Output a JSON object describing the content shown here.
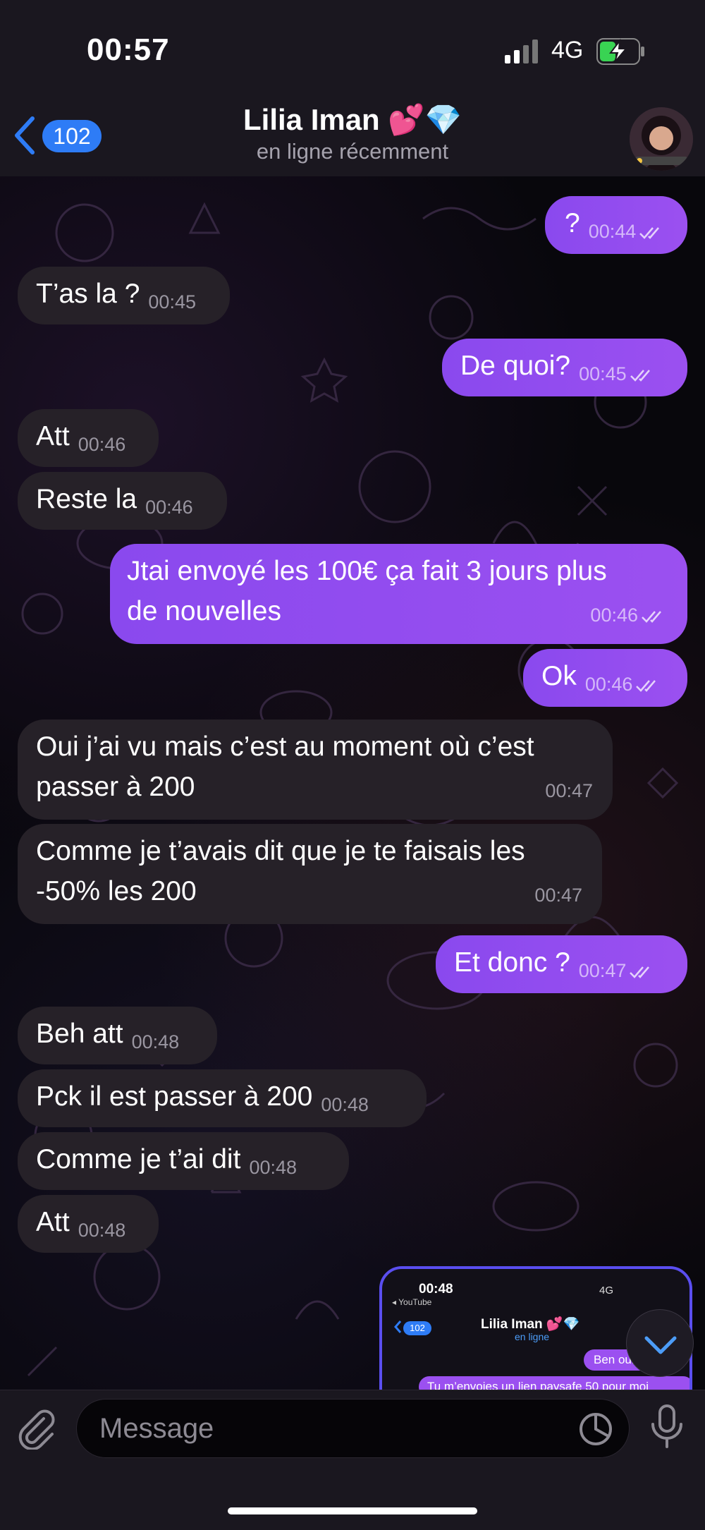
{
  "status": {
    "time": "00:57",
    "network": "4G"
  },
  "header": {
    "back_count": "102",
    "title": "Lilia Iman 💕💎",
    "subtitle": "en ligne récemment"
  },
  "messages": [
    {
      "dir": "out",
      "text": "?",
      "time": "00:44"
    },
    {
      "dir": "in",
      "text": "T’as la ?",
      "time": "00:45"
    },
    {
      "dir": "out",
      "text": "De quoi?",
      "time": "00:45"
    },
    {
      "dir": "in",
      "text": "Att",
      "time": "00:46"
    },
    {
      "dir": "in",
      "text": "Reste la",
      "time": "00:46"
    },
    {
      "dir": "out",
      "text_line1": "Jtai envoyé les 100€ ça fait 3 jours plus",
      "text_line2": "de nouvelles",
      "time": "00:46"
    },
    {
      "dir": "out",
      "text": "Ok",
      "time": "00:46"
    },
    {
      "dir": "in",
      "text_line1": "Oui j’ai vu mais c’est au moment où c’est",
      "text_line2": "passer à 200",
      "time": "00:47"
    },
    {
      "dir": "in",
      "text_line1": "Comme je t’avais dit que je te faisais les",
      "text_line2": "-50% les 200",
      "time": "00:47"
    },
    {
      "dir": "out",
      "text": "Et donc ?",
      "time": "00:47"
    },
    {
      "dir": "in",
      "text": "Beh att",
      "time": "00:48"
    },
    {
      "dir": "in",
      "text": "Pck il est passer à 200",
      "time": "00:48"
    },
    {
      "dir": "in",
      "text": "Comme je t’ai dit",
      "time": "00:48"
    },
    {
      "dir": "in",
      "text": "Att",
      "time": "00:48"
    }
  ],
  "screenshot_preview": {
    "time": "00:48",
    "source": "◂ YouTube",
    "status": "4G",
    "back_count": "102",
    "title": "Lilia Iman 💕💎",
    "subtitle": "en ligne",
    "msg1": "Ben oui",
    "msg2": "Tu m’envoies un lien paysafe 50 pour moi"
  },
  "input": {
    "placeholder": "Message"
  },
  "colors": {
    "accent": "#2e7cf6",
    "outgoing": "#9b50f0",
    "incoming": "#262128",
    "bar": "#1a171f"
  }
}
